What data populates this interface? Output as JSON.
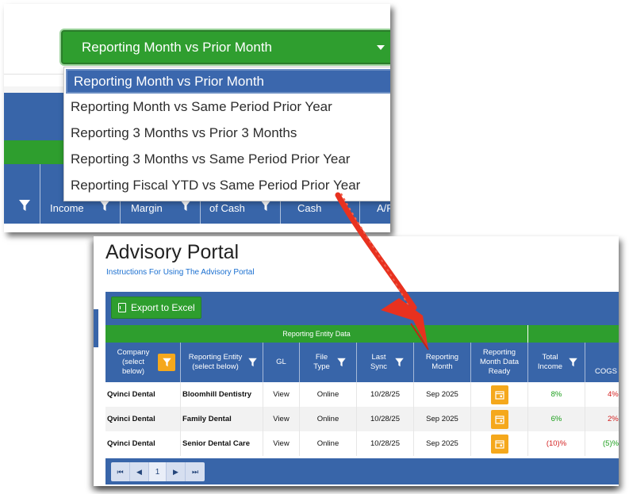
{
  "top_panel": {
    "dropdown": {
      "selected_label": "Reporting Month vs Prior Month",
      "options": [
        "Reporting Month vs Prior Month",
        "Reporting Month vs Same Period Prior Year",
        "Reporting 3 Months vs Prior 3 Months",
        "Reporting 3 Months vs Same Period Prior Year",
        "Reporting Fiscal YTD vs Same Period Prior Year"
      ]
    },
    "columns": [
      "Income",
      "Margin",
      "of Cash",
      "Cash",
      "A/R"
    ]
  },
  "portal": {
    "title": "Advisory Portal",
    "instructions_link": "Instructions For Using The Advisory Portal",
    "export_label": "Export to Excel",
    "group_header": "Reporting Entity Data",
    "headers": {
      "company": "Company (select below)",
      "entity": "Reporting Entity (select below)",
      "gl": "GL",
      "file_type": "File Type",
      "last_sync": "Last Sync",
      "reporting_month": "Reporting Month",
      "data_ready": "Reporting Month Data Ready",
      "total_income": "Total Income",
      "cogs": "COGS"
    },
    "rows": [
      {
        "company": "Qvinci Dental",
        "entity": "Bloomhill Dentistry",
        "gl": "View",
        "file_type": "Online",
        "last_sync": "10/28/25",
        "month": "Sep 2025",
        "income": "8%",
        "cogs": "4%"
      },
      {
        "company": "Qvinci Dental",
        "entity": "Family Dental",
        "gl": "View",
        "file_type": "Online",
        "last_sync": "10/28/25",
        "month": "Sep 2025",
        "income": "6%",
        "cogs": "2%"
      },
      {
        "company": "Qvinci Dental",
        "entity": "Senior Dental Care",
        "gl": "View",
        "file_type": "Online",
        "last_sync": "10/28/25",
        "month": "Sep 2025",
        "income": "(10)%",
        "cogs": "(5)%"
      }
    ],
    "pager": {
      "first": "⏮",
      "prev": "◀",
      "page": "1",
      "next": "▶",
      "last": "⏭"
    }
  },
  "colors": {
    "accent_green": "#2e9e2e",
    "header_blue": "#3865a9",
    "filter_orange": "#f5a81c",
    "arrow_red": "#e8311f"
  }
}
